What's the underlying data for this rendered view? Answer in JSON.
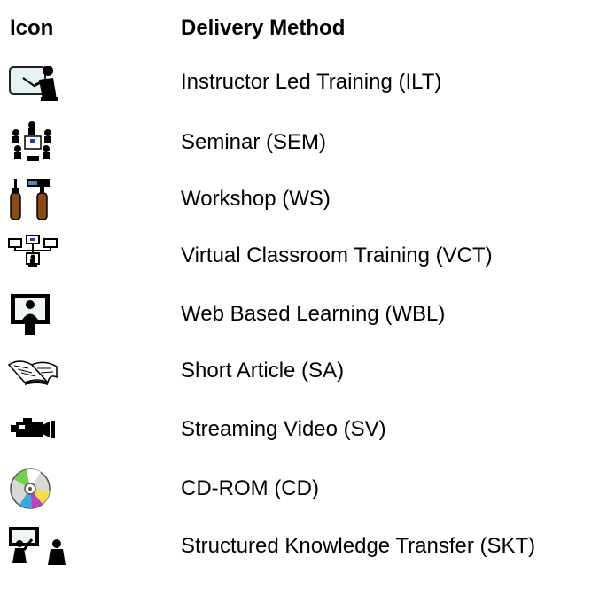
{
  "header": {
    "icon_column": "Icon",
    "method_column": "Delivery Method"
  },
  "methods": [
    {
      "label": "Instructor Led Training (ILT)",
      "icon": "instructor-icon"
    },
    {
      "label": "Seminar (SEM)",
      "icon": "seminar-group-icon"
    },
    {
      "label": "Workshop (WS)",
      "icon": "tools-icon"
    },
    {
      "label": "Virtual Classroom Training (VCT)",
      "icon": "network-computers-icon"
    },
    {
      "label": "Web Based Learning (WBL)",
      "icon": "monitor-person-icon"
    },
    {
      "label": "Short Article (SA)",
      "icon": "open-book-icon"
    },
    {
      "label": "Streaming Video (SV)",
      "icon": "video-camera-icon"
    },
    {
      "label": "CD-ROM (CD)",
      "icon": "cd-rom-icon"
    },
    {
      "label": "Structured Knowledge Transfer (SKT)",
      "icon": "presenter-board-icon"
    }
  ]
}
